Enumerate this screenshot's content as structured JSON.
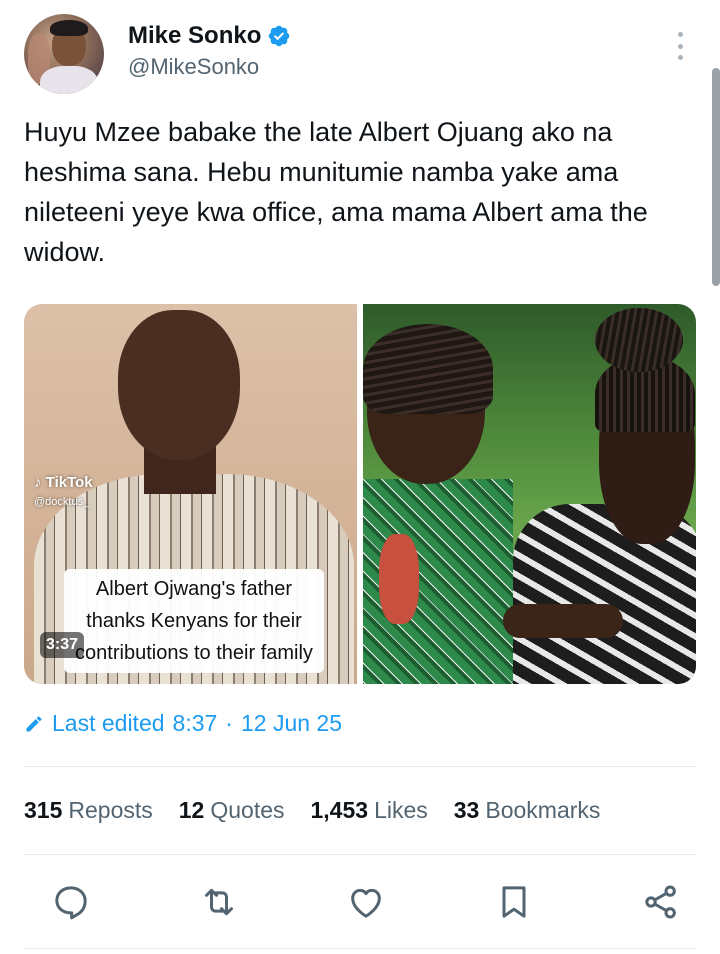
{
  "author": {
    "display_name": "Mike Sonko",
    "handle": "@MikeSonko",
    "verified": true,
    "avatar_icon": "profile-photo"
  },
  "tweet": {
    "text": "Huyu Mzee babake the late Albert Ojuang ako na heshima sana. Hebu munitumie namba yake ama nileteeni yeye kwa office, ama mama Albert ama the widow."
  },
  "media": {
    "left": {
      "watermark": "TikTok",
      "watermark_handle": "@docktus_",
      "caption": "Albert Ojwang's father thanks Kenyans for their contributions to their family",
      "duration": "3:37"
    },
    "right": {}
  },
  "edit": {
    "label": "Last edited",
    "time": "8:37",
    "separator": "·",
    "date": "12 Jun 25"
  },
  "stats": [
    {
      "value": "315",
      "label": "Reposts"
    },
    {
      "value": "12",
      "label": "Quotes"
    },
    {
      "value": "1,453",
      "label": "Likes"
    },
    {
      "value": "33",
      "label": "Bookmarks"
    }
  ],
  "actions": [
    "reply-icon",
    "repost-icon",
    "like-icon",
    "bookmark-icon",
    "share-icon"
  ],
  "colors": {
    "accent": "#1d9bf0",
    "text": "#0f1419",
    "muted": "#536471",
    "divider": "#e6ecf0"
  }
}
